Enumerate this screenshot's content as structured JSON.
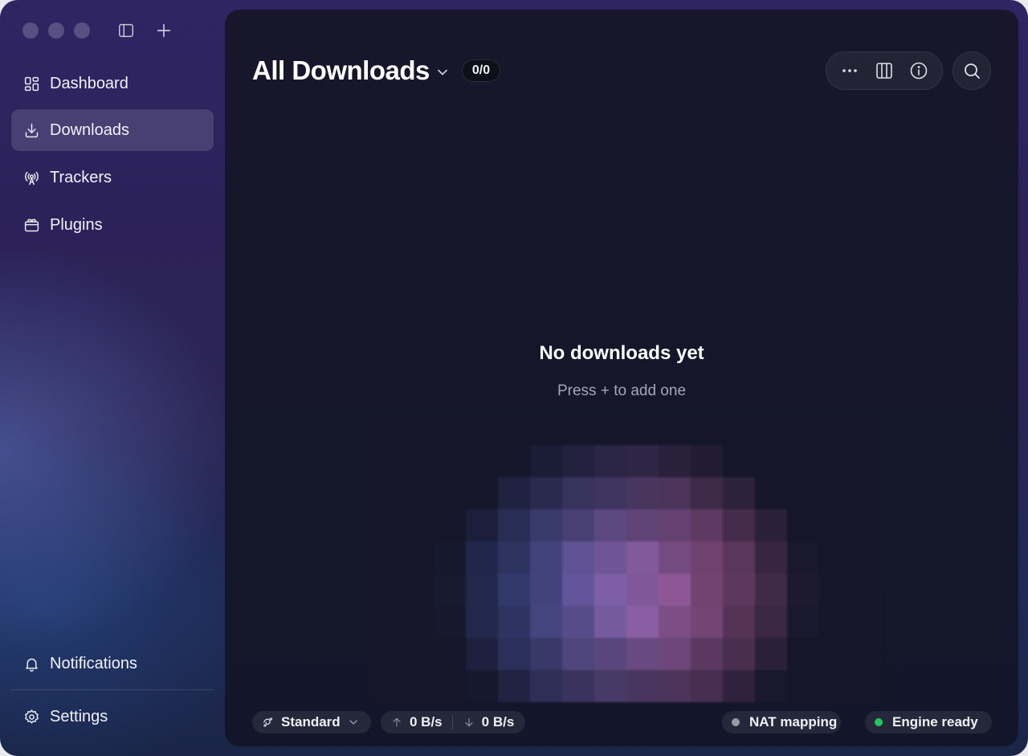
{
  "sidebar": {
    "items": [
      {
        "label": "Dashboard",
        "icon": "dashboard-icon"
      },
      {
        "label": "Downloads",
        "icon": "download-icon",
        "active": true
      },
      {
        "label": "Trackers",
        "icon": "tracker-antenna-icon"
      },
      {
        "label": "Plugins",
        "icon": "plugin-icon"
      }
    ],
    "bottom_items": [
      {
        "label": "Notifications",
        "icon": "bell-icon"
      },
      {
        "label": "Settings",
        "icon": "gear-icon"
      }
    ]
  },
  "header": {
    "title": "All Downloads",
    "count_badge": "0/0"
  },
  "empty_state": {
    "title": "No downloads yet",
    "subtitle": "Press + to add one"
  },
  "status_bar": {
    "mode_label": "Standard",
    "upload_speed": "0 B/s",
    "download_speed": "0 B/s",
    "nat_label": "NAT mapping",
    "nat_status_color": "#9a9aa6",
    "engine_label": "Engine ready",
    "engine_status_color": "#22c55e"
  },
  "colors": {
    "accent_blue": "#4a62b8",
    "accent_pink": "#b8609e",
    "panel_bg": "#15162a"
  }
}
